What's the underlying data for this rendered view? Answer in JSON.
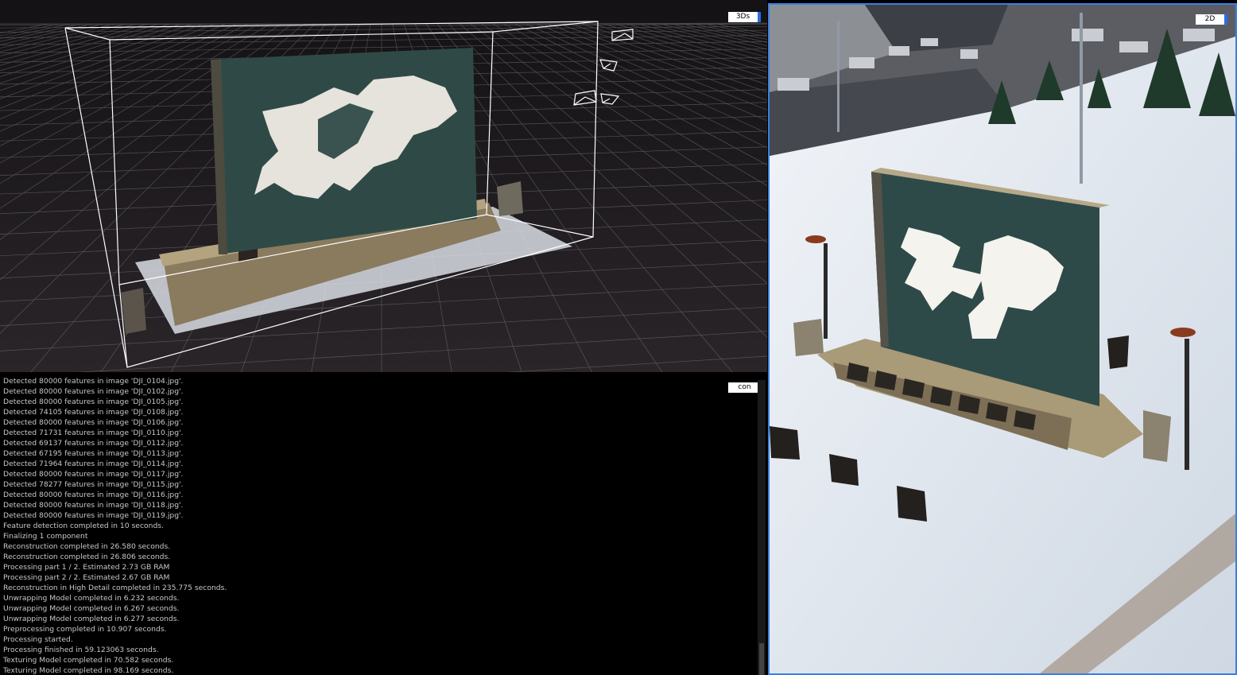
{
  "viewport3d": {
    "tag": "3Ds"
  },
  "viewport2d": {
    "tag": "2D"
  },
  "console": {
    "tag": "con",
    "lines": [
      "Detected 80000 features in image 'DJI_0104.jpg'.",
      "Detected 80000 features in image 'DJI_0102.jpg'.",
      "Detected 80000 features in image 'DJI_0105.jpg'.",
      "Detected 74105 features in image 'DJI_0108.jpg'.",
      "Detected 80000 features in image 'DJI_0106.jpg'.",
      "Detected 71731 features in image 'DJI_0110.jpg'.",
      "Detected 69137 features in image 'DJI_0112.jpg'.",
      "Detected 67195 features in image 'DJI_0113.jpg'.",
      "Detected 71964 features in image 'DJI_0114.jpg'.",
      "Detected 80000 features in image 'DJI_0117.jpg'.",
      "Detected 78277 features in image 'DJI_0115.jpg'.",
      "Detected 80000 features in image 'DJI_0116.jpg'.",
      "Detected 80000 features in image 'DJI_0118.jpg'.",
      "Detected 80000 features in image 'DJI_0119.jpg'.",
      "Feature detection completed in 10 seconds.",
      "Finalizing 1 component",
      "Reconstruction completed in 26.580 seconds.",
      "Reconstruction completed in 26.806 seconds.",
      "Processing part 1 / 2. Estimated 2.73 GB RAM",
      "Processing part 2 / 2. Estimated 2.67 GB RAM",
      "Reconstruction in High Detail completed in 235.775 seconds.",
      "Unwrapping Model completed in 6.232 seconds.",
      "Unwrapping Model completed in 6.267 seconds.",
      "Unwrapping Model completed in 6.277 seconds.",
      "Preprocessing completed in 10.907 seconds.",
      "Processing started.",
      "Processing finished in 59.123063 seconds.",
      "Texturing Model completed in 70.582 seconds.",
      "Texturing Model completed in 98.169 seconds."
    ]
  },
  "colors": {
    "accent": "#3a7fe0",
    "grid": "#8a8a8a",
    "snow": "#e9eef4",
    "bronze": "#2f4a46"
  }
}
